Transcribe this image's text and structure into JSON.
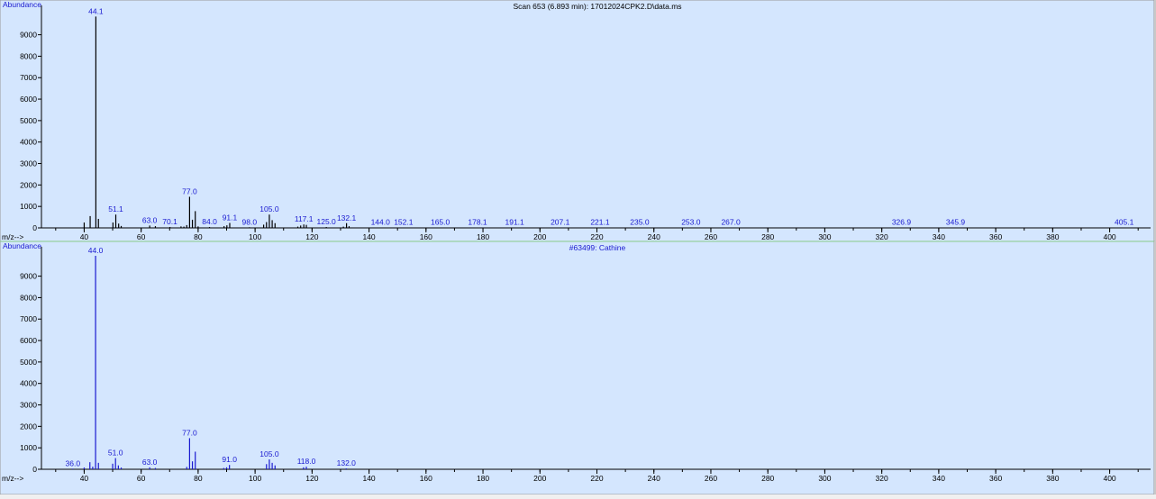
{
  "chart_data": [
    {
      "type": "bar",
      "title": "Scan 653 (6.893 min): 17012024CPK2.D\\data.ms",
      "ylabel": "Abundance",
      "xlabel": "m/z-->",
      "xlim": [
        25,
        415
      ],
      "ylim": [
        0,
        10200
      ],
      "x_ticks": [
        40,
        60,
        80,
        100,
        120,
        140,
        160,
        180,
        200,
        220,
        240,
        260,
        280,
        300,
        320,
        340,
        360,
        380,
        400
      ],
      "y_ticks": [
        0,
        1000,
        2000,
        3000,
        4000,
        5000,
        6000,
        7000,
        8000,
        9000
      ],
      "bar_color": "#000000",
      "label_color": "#1a1ad0",
      "peaks": [
        {
          "x": 40.0,
          "y": 250
        },
        {
          "x": 42.1,
          "y": 550
        },
        {
          "x": 44.1,
          "y": 9850
        },
        {
          "x": 45.0,
          "y": 420
        },
        {
          "x": 50.1,
          "y": 250
        },
        {
          "x": 51.1,
          "y": 620
        },
        {
          "x": 52.1,
          "y": 200
        },
        {
          "x": 53.0,
          "y": 90
        },
        {
          "x": 63.0,
          "y": 110
        },
        {
          "x": 65.0,
          "y": 80
        },
        {
          "x": 70.1,
          "y": 40
        },
        {
          "x": 74.0,
          "y": 70
        },
        {
          "x": 75.0,
          "y": 60
        },
        {
          "x": 76.0,
          "y": 130
        },
        {
          "x": 77.0,
          "y": 1450
        },
        {
          "x": 78.0,
          "y": 380
        },
        {
          "x": 79.0,
          "y": 780
        },
        {
          "x": 80.0,
          "y": 70
        },
        {
          "x": 84.0,
          "y": 40
        },
        {
          "x": 89.1,
          "y": 80
        },
        {
          "x": 90.1,
          "y": 120
        },
        {
          "x": 91.1,
          "y": 230
        },
        {
          "x": 98.0,
          "y": 30
        },
        {
          "x": 103.0,
          "y": 150
        },
        {
          "x": 104.0,
          "y": 270
        },
        {
          "x": 105.0,
          "y": 620
        },
        {
          "x": 106.0,
          "y": 360
        },
        {
          "x": 107.0,
          "y": 220
        },
        {
          "x": 115.0,
          "y": 60
        },
        {
          "x": 116.0,
          "y": 110
        },
        {
          "x": 117.1,
          "y": 160
        },
        {
          "x": 118.0,
          "y": 140
        },
        {
          "x": 125.0,
          "y": 40
        },
        {
          "x": 131.0,
          "y": 60
        },
        {
          "x": 132.1,
          "y": 220
        },
        {
          "x": 133.0,
          "y": 80
        },
        {
          "x": 144.0,
          "y": 20
        },
        {
          "x": 152.1,
          "y": 20
        },
        {
          "x": 165.0,
          "y": 20
        },
        {
          "x": 178.1,
          "y": 20
        },
        {
          "x": 191.1,
          "y": 20
        },
        {
          "x": 207.1,
          "y": 20
        },
        {
          "x": 221.1,
          "y": 20
        },
        {
          "x": 235.0,
          "y": 20
        },
        {
          "x": 253.0,
          "y": 20
        },
        {
          "x": 267.0,
          "y": 20
        },
        {
          "x": 326.9,
          "y": 20
        },
        {
          "x": 345.9,
          "y": 20
        },
        {
          "x": 405.1,
          "y": 20
        }
      ],
      "annotations": [
        {
          "x": 44.1,
          "y": 9850,
          "text": "44.1"
        },
        {
          "x": 51.1,
          "y": 620,
          "text": "51.1"
        },
        {
          "x": 63.0,
          "y": 110,
          "text": "63.0"
        },
        {
          "x": 70.1,
          "y": 40,
          "text": "70.1"
        },
        {
          "x": 77.0,
          "y": 1450,
          "text": "77.0"
        },
        {
          "x": 84.0,
          "y": 40,
          "text": "84.0"
        },
        {
          "x": 91.1,
          "y": 230,
          "text": "91.1"
        },
        {
          "x": 98.0,
          "y": 30,
          "text": "98.0"
        },
        {
          "x": 105.0,
          "y": 620,
          "text": "105.0"
        },
        {
          "x": 117.1,
          "y": 160,
          "text": "117.1"
        },
        {
          "x": 125.0,
          "y": 40,
          "text": "125.0"
        },
        {
          "x": 132.1,
          "y": 220,
          "text": "132.1"
        },
        {
          "x": 144.0,
          "y": 20,
          "text": "144.0"
        },
        {
          "x": 152.1,
          "y": 20,
          "text": "152.1"
        },
        {
          "x": 165.0,
          "y": 20,
          "text": "165.0"
        },
        {
          "x": 178.1,
          "y": 20,
          "text": "178.1"
        },
        {
          "x": 191.1,
          "y": 20,
          "text": "191.1"
        },
        {
          "x": 207.1,
          "y": 20,
          "text": "207.1"
        },
        {
          "x": 221.1,
          "y": 20,
          "text": "221.1"
        },
        {
          "x": 235.0,
          "y": 20,
          "text": "235.0"
        },
        {
          "x": 253.0,
          "y": 20,
          "text": "253.0"
        },
        {
          "x": 267.0,
          "y": 20,
          "text": "267.0"
        },
        {
          "x": 326.9,
          "y": 20,
          "text": "326.9"
        },
        {
          "x": 345.9,
          "y": 20,
          "text": "345.9"
        },
        {
          "x": 405.1,
          "y": 20,
          "text": "405.1"
        }
      ]
    },
    {
      "type": "bar",
      "title": "#63499: Cathine",
      "ylabel": "Abundance",
      "xlabel": "m/z-->",
      "xlim": [
        25,
        415
      ],
      "ylim": [
        0,
        10200
      ],
      "x_ticks": [
        40,
        60,
        80,
        100,
        120,
        140,
        160,
        180,
        200,
        220,
        240,
        260,
        280,
        300,
        320,
        340,
        360,
        380,
        400
      ],
      "y_ticks": [
        0,
        1000,
        2000,
        3000,
        4000,
        5000,
        6000,
        7000,
        8000,
        9000
      ],
      "bar_color": "#1a1ad0",
      "label_color": "#1a1ad0",
      "peaks": [
        {
          "x": 36.0,
          "y": 30
        },
        {
          "x": 40.0,
          "y": 80
        },
        {
          "x": 42.0,
          "y": 330
        },
        {
          "x": 43.0,
          "y": 120
        },
        {
          "x": 44.0,
          "y": 9950
        },
        {
          "x": 45.0,
          "y": 300
        },
        {
          "x": 50.0,
          "y": 260
        },
        {
          "x": 51.0,
          "y": 520
        },
        {
          "x": 52.0,
          "y": 180
        },
        {
          "x": 53.0,
          "y": 80
        },
        {
          "x": 63.0,
          "y": 90
        },
        {
          "x": 65.0,
          "y": 60
        },
        {
          "x": 76.0,
          "y": 110
        },
        {
          "x": 77.0,
          "y": 1450
        },
        {
          "x": 78.0,
          "y": 370
        },
        {
          "x": 79.0,
          "y": 820
        },
        {
          "x": 89.0,
          "y": 60
        },
        {
          "x": 90.0,
          "y": 90
        },
        {
          "x": 91.0,
          "y": 200
        },
        {
          "x": 104.0,
          "y": 240
        },
        {
          "x": 105.0,
          "y": 460
        },
        {
          "x": 106.0,
          "y": 300
        },
        {
          "x": 107.0,
          "y": 180
        },
        {
          "x": 117.0,
          "y": 90
        },
        {
          "x": 118.0,
          "y": 120
        },
        {
          "x": 132.0,
          "y": 40
        }
      ],
      "annotations": [
        {
          "x": 36.0,
          "y": 30,
          "text": "36.0"
        },
        {
          "x": 44.0,
          "y": 9950,
          "text": "44.0"
        },
        {
          "x": 51.0,
          "y": 520,
          "text": "51.0"
        },
        {
          "x": 63.0,
          "y": 90,
          "text": "63.0"
        },
        {
          "x": 77.0,
          "y": 1450,
          "text": "77.0"
        },
        {
          "x": 91.0,
          "y": 200,
          "text": "91.0"
        },
        {
          "x": 105.0,
          "y": 460,
          "text": "105.0"
        },
        {
          "x": 118.0,
          "y": 120,
          "text": "118.0"
        },
        {
          "x": 132.0,
          "y": 40,
          "text": "132.0"
        }
      ]
    }
  ]
}
